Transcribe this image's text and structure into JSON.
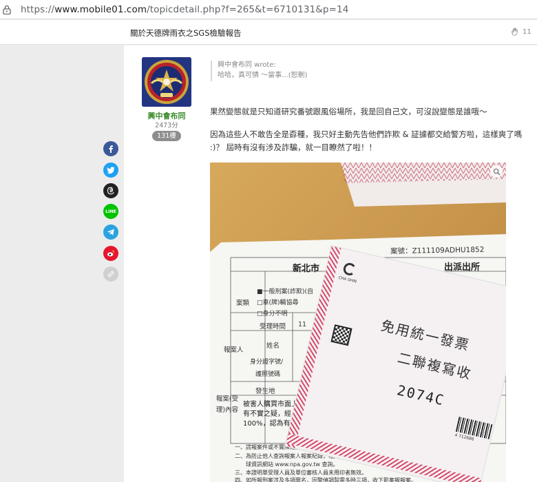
{
  "browser": {
    "url_scheme": "https://",
    "url_host": "www.mobile01.com",
    "url_path": "/topicdetail.php?f=265&t=6710131&p=14"
  },
  "topic": {
    "title": "關於天德牌雨衣之SGS檢驗報告",
    "like_count": "11"
  },
  "author": {
    "name": "興中會布同",
    "score": "2473分",
    "floor": "131樓"
  },
  "quote": {
    "author_line": "興中會布同 wrote:",
    "text": "哈哈，真可憐 ～當事...(恕刪)"
  },
  "post": {
    "paragraph1": "果然變態就是只知道研究番號跟風俗場所，我是回自己文，可沒說變態是誰哦～",
    "paragraph2": "因為這些人不敢告全是孬種，我只好主動先告他們詐欺 & 証據都交給警方啦，這樣爽了嗎 :)？ 屆時有沒有涉及詐騙，就一目瞭然了啦！！"
  },
  "photo_text": {
    "case_no": "案號：Z111109ADHU1852",
    "station_left": "新北市",
    "station_right": "出派出所",
    "row_type": "案類",
    "type_opt1": "■一般刑案(詐欺)(自",
    "type_opt2": "□車(牌)輛協尋",
    "type_opt3": "□身分不明",
    "row_time": "受理時間",
    "time_val": "11",
    "row_reporter": "報案人",
    "row_name": "姓名",
    "row_id": "身分證字號/",
    "row_passport": "護照號碼",
    "row_place": "發生地",
    "row_content": "報案(受理)內容",
    "content_line1": "被害人購買市面上常見雨衣，",
    "content_line2": "有不實之疑，經 SGS 鑑測後，其購買之 5",
    "content_line3": "100%，認為有詐欺之情事，故至派出所報案。",
    "note1": "一、謊報案件或不實陳述觸犯法令，將追究相關法律責任，得處七年以下有期徒刑。",
    "note2": "二、為防止他人查詢報案人報案紀錄，報案人須提供正確姓名及身分證字號，方可於報案 2 日後",
    "note2b": "球資訊網站 www.npa.gov.tw 查詢。",
    "note3": "三、本證明單受理人員及單位審核人員未用印者無效。",
    "note4": "四、如所報刑案涉及多項罪名，因警偵調製需多時三項，收下影案報報案。",
    "invoice_brand": "CHA SHIN",
    "invoice_title1": "免用統一發票",
    "invoice_title2": "二聯複寫收",
    "invoice_code": "2074C",
    "barcode_text": "4 712686"
  },
  "colors": {
    "facebook": "#3b5998",
    "twitter": "#1da1f2",
    "threads": "#222222",
    "line": "#00c300",
    "telegram": "#2aa3e0",
    "weibo": "#e6162d",
    "link": "#d0d0d0",
    "author_name": "#3a8a2a"
  },
  "icons": {
    "lock": "lock-icon",
    "like": "clap-icon",
    "zoom": "zoom-icon",
    "share": [
      "facebook-icon",
      "twitter-icon",
      "threads-icon",
      "line-icon",
      "telegram-icon",
      "weibo-icon",
      "link-icon"
    ],
    "share_line_label": "LINE"
  }
}
